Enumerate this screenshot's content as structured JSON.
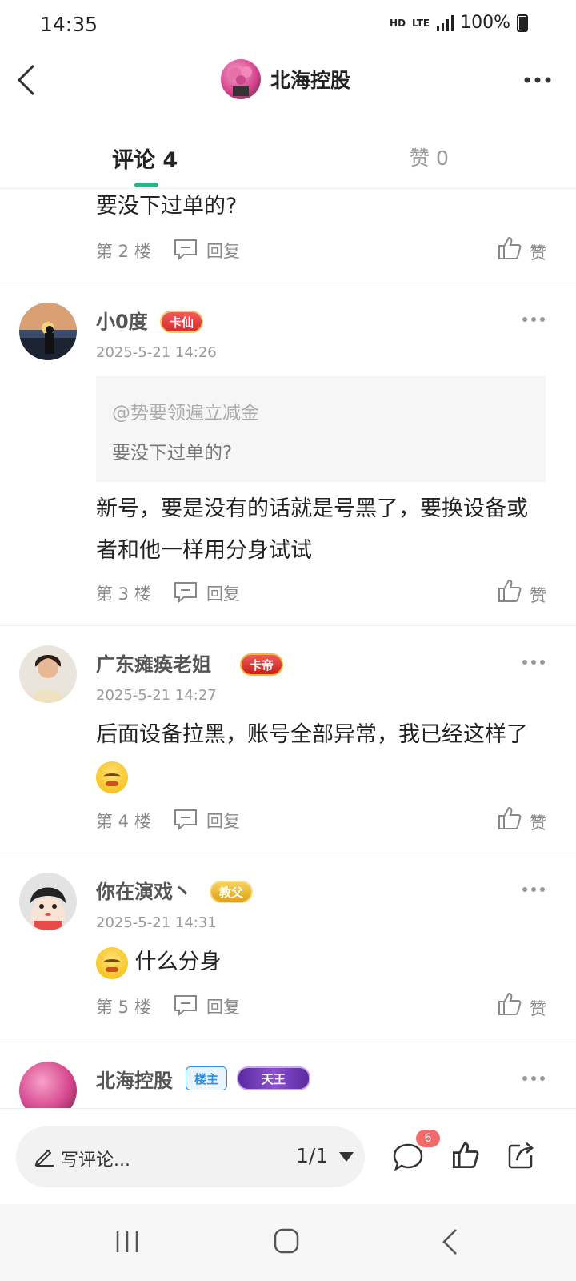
{
  "status_bar": {
    "time": "14:35",
    "network": "HD",
    "lte": "LTE",
    "battery": "100%"
  },
  "header": {
    "title": "北海控股",
    "icons": [
      "back-icon",
      "more-icon"
    ]
  },
  "tabs": {
    "comments": "评论 4",
    "likes": "赞 0"
  },
  "comments": [
    {
      "content": "要没下过单的?",
      "floor": "第 2 楼",
      "reply": "回复",
      "like": "赞"
    },
    {
      "username": "小0度",
      "badge": "卡仙",
      "timestamp": "2025-5-21 14:26",
      "quote_user": "@势要领遍立减金",
      "quote_text": "要没下过单的?",
      "content": "新号，要是没有的话就是号黑了，要换设备或者和他一样用分身试试",
      "floor": "第 3 楼",
      "reply": "回复",
      "like": "赞"
    },
    {
      "username": "广东瘫痪老姐",
      "badge": "卡帝",
      "timestamp": "2025-5-21 14:27",
      "content": "后面设备拉黑，账号全部异常，我已经这样了",
      "floor": "第 4 楼",
      "reply": "回复",
      "like": "赞"
    },
    {
      "username": "你在演戏丶",
      "badge": "教父",
      "timestamp": "2025-5-21 14:31",
      "content": "什么分身",
      "floor": "第 5 楼",
      "reply": "回复",
      "like": "赞"
    },
    {
      "username": "北海控股",
      "badge_owner": "楼主",
      "badge": "天王"
    }
  ],
  "bottom_bar": {
    "placeholder": "写评论...",
    "page": "1/1",
    "comment_count": "6"
  },
  "colors": {
    "accent": "#2bb38a",
    "badge_red": "#f36a6a",
    "owner_blue": "#2a8fe0"
  }
}
